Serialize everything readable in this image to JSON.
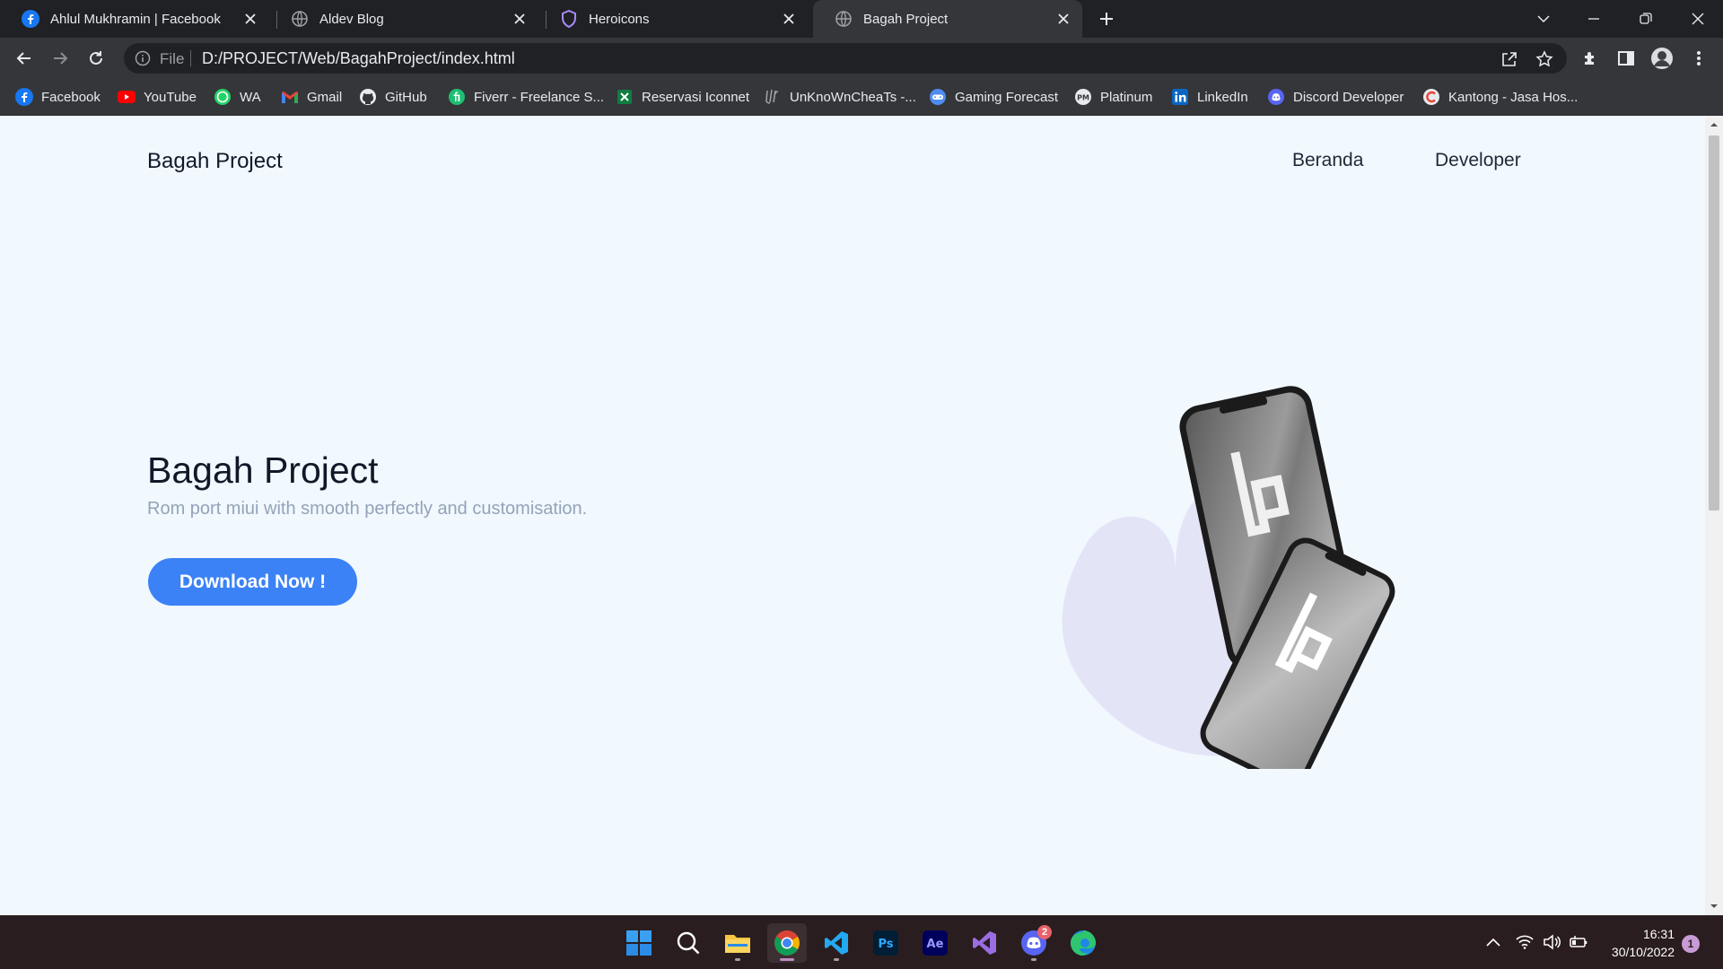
{
  "browser": {
    "tabs": [
      {
        "title": "Ahlul Mukhramin | Facebook",
        "active": false
      },
      {
        "title": "Aldev Blog",
        "active": false
      },
      {
        "title": "Heroicons",
        "active": false
      },
      {
        "title": "Bagah Project",
        "active": true
      }
    ],
    "address": {
      "scheme": "File",
      "url": "D:/PROJECT/Web/BagahProject/index.html"
    },
    "bookmarks": [
      {
        "label": "Facebook",
        "icon": "facebook-icon"
      },
      {
        "label": "YouTube",
        "icon": "youtube-icon"
      },
      {
        "label": "WA",
        "icon": "whatsapp-icon"
      },
      {
        "label": "Gmail",
        "icon": "gmail-icon"
      },
      {
        "label": "GitHub",
        "icon": "github-icon"
      },
      {
        "label": "Fiverr - Freelance S...",
        "icon": "fiverr-icon"
      },
      {
        "label": "Reservasi Iconnet",
        "icon": "excel-icon"
      },
      {
        "label": "UnKnoWnCheaTs -...",
        "icon": "uc-icon"
      },
      {
        "label": "Gaming Forecast",
        "icon": "gaming-icon"
      },
      {
        "label": "Platinum",
        "icon": "platinum-icon"
      },
      {
        "label": "LinkedIn",
        "icon": "linkedin-icon"
      },
      {
        "label": "Discord Developer",
        "icon": "discord-icon"
      },
      {
        "label": "Kantong - Jasa Hos...",
        "icon": "kantong-icon"
      }
    ]
  },
  "site": {
    "brand": "Bagah Project",
    "nav": [
      "Beranda",
      "Developer"
    ],
    "hero": {
      "title": "Bagah Project",
      "subtitle": "Rom port miui with smooth perfectly and customisation.",
      "cta": "Download Now !"
    }
  },
  "taskbar": {
    "discord_badge": "2",
    "time": "16:31",
    "date": "30/10/2022",
    "notifications": "1"
  },
  "colors": {
    "page_bg": "#f1f8fe",
    "cta": "#3b82f6",
    "blob": "#e4e4f7",
    "tab_bar": "#202124",
    "toolbar": "#35363a",
    "taskbar": "#2a1d1f"
  }
}
